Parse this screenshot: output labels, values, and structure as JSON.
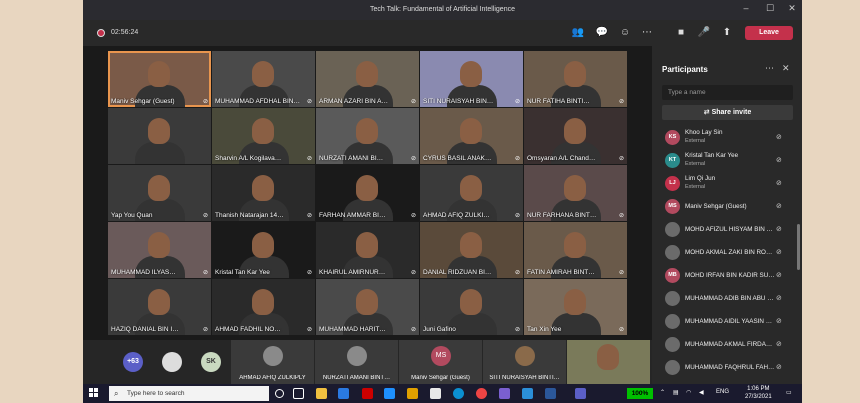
{
  "window": {
    "title": "Tech Talk: Fundamental of Artificial Intelligence"
  },
  "toolbar": {
    "timer": "02:56:24",
    "leave_label": "Leave"
  },
  "tiles": [
    {
      "name": "Maniv Sehgar (Guest)",
      "active": true
    },
    {
      "name": "MUHAMMAD AFDHAL BIN…"
    },
    {
      "name": "ARMAN AZARI BIN A…"
    },
    {
      "name": "SITI NURAISYAH BIN…"
    },
    {
      "name": "NUR FATIHA BINTI…"
    },
    {
      "name": ""
    },
    {
      "name": "Sharvin A/L Kogilava…"
    },
    {
      "name": "NURZATI AMANI BI…"
    },
    {
      "name": "CYRUS BASIL ANAK…"
    },
    {
      "name": "Omsyaran A/L Chand…"
    },
    {
      "name": "Yap You Quan"
    },
    {
      "name": "Thanish Natarajan 14…"
    },
    {
      "name": "FARHAN AMMAR BI…"
    },
    {
      "name": "AHMAD AFIQ ZULKI…"
    },
    {
      "name": "NUR FARHANA BINT…"
    },
    {
      "name": "MUHAMMAD ILYAS…"
    },
    {
      "name": "Kristal Tan Kar Yee"
    },
    {
      "name": "KHAIRUL AMIRNUR…"
    },
    {
      "name": "DANIAL RIDZUAN BI…"
    },
    {
      "name": "FATIN AMIRAH BINT…"
    },
    {
      "name": "HAZIQ DANIAL BIN I…"
    },
    {
      "name": "AHMAD FADHIL NO…"
    },
    {
      "name": "MUHAMMAD HARIT…"
    },
    {
      "name": "Juni Gafino"
    },
    {
      "name": "Tan Xin Yee"
    }
  ],
  "bottom": {
    "overflow_count": "+63",
    "sk_initials": "SK",
    "tiles": [
      {
        "name": "AHMAD AFIQ ZULKIPLY",
        "initials": ""
      },
      {
        "name": "NURZATI AMANI BINT…",
        "initials": ""
      },
      {
        "name": "Maniv Sehgar (Guest)",
        "initials": "MS"
      },
      {
        "name": "SITI NURAISYAH BINTI…",
        "initials": ""
      }
    ]
  },
  "participants": {
    "title": "Participants",
    "search_placeholder": "Type a name",
    "share_invite_label": "Share invite",
    "external_label": "External",
    "list": [
      {
        "initials": "KS",
        "name": "Khoo Lay Sin",
        "external": true,
        "color": "#b24a5f"
      },
      {
        "initials": "KT",
        "name": "Kristal Tan Kar Yee",
        "external": true,
        "color": "#2a8c8c"
      },
      {
        "initials": "LJ",
        "name": "Lim Qi Jun",
        "external": true,
        "color": "#c4314b"
      },
      {
        "initials": "MS",
        "name": "Maniv Sehgar (Guest)",
        "external": false,
        "color": "#b24a5f"
      },
      {
        "initials": "",
        "name": "MOHD AFIZUL HISYAM BIN …",
        "external": false,
        "color": "#6b6b6b"
      },
      {
        "initials": "",
        "name": "MOHD AKMAL ZAKI BIN ROH…",
        "external": false,
        "color": "#6b6b6b"
      },
      {
        "initials": "MB",
        "name": "MOHD IRFAN BIN KADIR SUL…",
        "external": false,
        "color": "#b24a5f"
      },
      {
        "initials": "",
        "name": "MUHAMMAD ADIB BIN ABU …",
        "external": false,
        "color": "#6b6b6b"
      },
      {
        "initials": "",
        "name": "MUHAMMAD AIDIL YAASIN B…",
        "external": false,
        "color": "#6b6b6b"
      },
      {
        "initials": "",
        "name": "MUHAMMAD AKMAL FIRDA…",
        "external": false,
        "color": "#6b6b6b"
      },
      {
        "initials": "",
        "name": "MUHAMMAD FAQHRUL FAH…",
        "external": false,
        "color": "#6b6b6b"
      }
    ]
  },
  "taskbar": {
    "search_placeholder": "Type here to search",
    "battery": "100%",
    "language": "ENG",
    "time": "1:06 PM",
    "date": "27/3/2021"
  }
}
